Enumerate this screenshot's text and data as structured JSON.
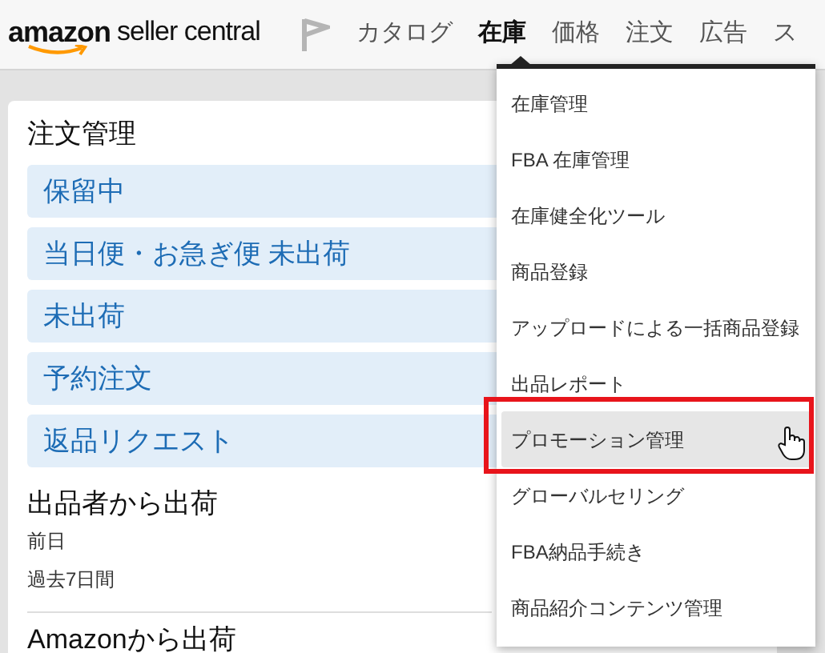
{
  "header": {
    "logo": {
      "brand": "amazon",
      "product": "seller central"
    },
    "nav": [
      {
        "label": "カタログ",
        "selected": false
      },
      {
        "label": "在庫",
        "selected": true
      },
      {
        "label": "価格",
        "selected": false
      },
      {
        "label": "注文",
        "selected": false
      },
      {
        "label": "広告",
        "selected": false
      },
      {
        "label": "ス",
        "selected": false
      }
    ]
  },
  "orders_card": {
    "title": "注文管理",
    "links": [
      "保留中",
      "当日便・お急ぎ便 未出荷",
      "未出荷",
      "予約注文",
      "返品リクエスト"
    ],
    "section_title": "出品者から出荷",
    "periods": [
      "前日",
      "過去7日間"
    ],
    "next_section": "Amazonから出荷"
  },
  "inventory_menu": {
    "items": [
      {
        "label": "在庫管理",
        "selected": false
      },
      {
        "label": "FBA 在庫管理",
        "selected": false
      },
      {
        "label": "在庫健全化ツール",
        "selected": false
      },
      {
        "label": "商品登録",
        "selected": false
      },
      {
        "label": "アップロードによる一括商品登録",
        "selected": false
      },
      {
        "label": "出品レポート",
        "selected": false
      },
      {
        "label": "プロモーション管理",
        "selected": true
      },
      {
        "label": "グローバルセリング",
        "selected": false
      },
      {
        "label": "FBA納品手続き",
        "selected": false
      },
      {
        "label": "商品紹介コンテンツ管理",
        "selected": false
      }
    ]
  }
}
